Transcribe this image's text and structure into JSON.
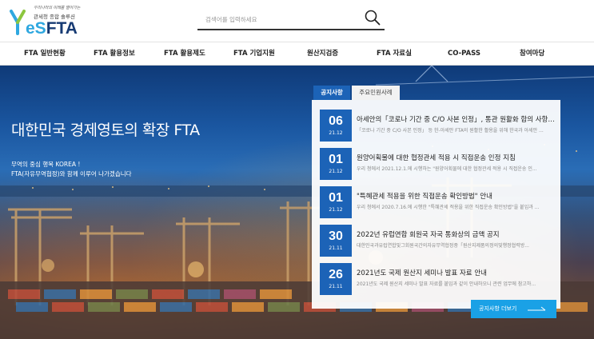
{
  "logo": {
    "tagline_small": "우리나라의 미래를 열어가는",
    "tagline": "관세청 종합 솔루션",
    "wordmark_e": "eS",
    "wordmark_rest": "FTA"
  },
  "search": {
    "placeholder": "검색어를 입력하세요"
  },
  "nav": {
    "items": [
      {
        "label": "FTA 일반현황"
      },
      {
        "label": "FTA 활용정보"
      },
      {
        "label": "FTA 활용제도"
      },
      {
        "label": "FTA 기업지원"
      },
      {
        "label": "원산지검증"
      },
      {
        "label": "FTA 자료실"
      },
      {
        "label": "CO-PASS"
      },
      {
        "label": "참여마당"
      }
    ]
  },
  "hero": {
    "title": "대한민국 경제영토의 확장 FTA",
    "line1": "무역의 중심 행복 KOREA !",
    "line2": "FTA(자유무역협정)와 함께 이루어 나가겠습니다"
  },
  "notices": {
    "tabs": [
      {
        "label": "공지사항"
      },
      {
        "label": "주요민원사례"
      }
    ],
    "items": [
      {
        "day": "06",
        "ym": "21.12",
        "title": "아세안의「코로나 기간 중 C/O 사본 인정」, 통관 원활화 합의 사항, 사...",
        "desc": "「코로나 기간 중 C/O 사본 인정」 등 한-아세안 FTA의 원활한 활용을 위해 한국과 아세안 ..."
      },
      {
        "day": "01",
        "ym": "21.12",
        "title": "원양어획물에 대한 협정관세 적용 시 직접운송 인정 지침",
        "desc": "우리 청에서 2021.12.1.에 시행하는 \"원양어획물에 대한 협정관세 적용 시 직접운송 인..."
      },
      {
        "day": "01",
        "ym": "21.12",
        "title": "\"특혜관세 적용을 위한 직접운송 확인방법\" 안내",
        "desc": "우리 청에서 2020.7.16.에 시행한 \"특혜관세 적용을 위한 직접운송 확인방법\"을 붙임과 ..."
      },
      {
        "day": "30",
        "ym": "21.11",
        "title": "2022년 유럽연합 회원국 자국 통화상의 금액 공지",
        "desc": "대한민국과유럽연합및그회원국간의자유무역협정중「원산지제품의정의및행정협력방..."
      },
      {
        "day": "26",
        "ym": "21.11",
        "title": "2021년도 국제 원산지 세미나 발표 자료 안내",
        "desc": "2021년도 국제 원산지 세미나 발표 자료를 붙임과 같이 안내하오니 관련 업무에 참고하..."
      }
    ],
    "more_label": "공지사항 더보기"
  },
  "colors": {
    "brand_navy": "#163a73",
    "brand_blue": "#1c63b7",
    "accent_sky": "#1aa1e6"
  }
}
